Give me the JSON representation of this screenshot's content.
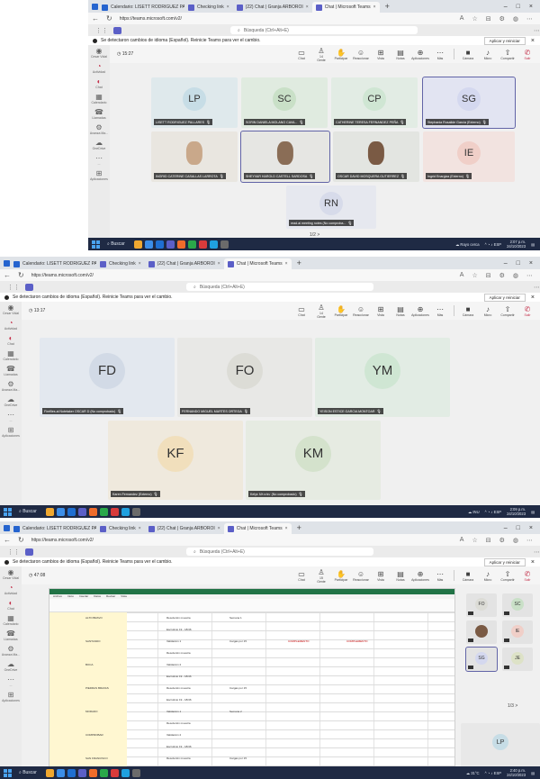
{
  "common": {
    "tabs": [
      {
        "label": "Calendario: LISETT RODRIGUEZ PA",
        "color": "#2564cf"
      },
      {
        "label": "Checking link",
        "color": "#5b5fc7"
      },
      {
        "label": "(22) Chat | Granja ARBOROI",
        "color": "#5b5fc7"
      },
      {
        "label": "Chat | Microsoft Teams",
        "color": "#5b5fc7"
      }
    ],
    "url": "https://teams.microsoft.com/v2/",
    "search_placeholder": "Búsqueda (Ctrl+Alt+E)",
    "banner_text": "Se detectaron cambios de idioma (Español). Reinicie Teams para ver el cambio.",
    "banner_button": "Aplicar y reiniciar",
    "rail": [
      "Cesar Vidal",
      "Actividad",
      "Chat",
      "Calendario",
      "Llamadas",
      "Avanza Ma...",
      "OneDrive",
      "...",
      "Aplicaciones"
    ],
    "controls": [
      "Chat",
      "Gente",
      "Participar",
      "Reaccionar",
      "Vista",
      "Notas",
      "Aplicaciones",
      "Más",
      "Cámara",
      "Micro",
      "Compartir",
      "Salir"
    ],
    "taskbar_search": "Buscar",
    "brand_color": "#5b5fc7"
  },
  "shot1": {
    "timer": "15:27",
    "people_count": "14",
    "pager": "1/2 >",
    "weather": "Rayo cerca",
    "clock": [
      "2:07 p.m.",
      "24/10/2023"
    ],
    "tiles": [
      {
        "initials": "LP",
        "name": "LISETT RODRIGUEZ PALLARES",
        "bg": "#dfe9ec",
        "av": "#c7dde6"
      },
      {
        "initials": "SC",
        "name": "SORIN DANIELA MOLANO CAVA...",
        "bg": "#e0ebe0",
        "av": "#c9e0c7"
      },
      {
        "initials": "CP",
        "name": "CATHERINE TERESA FERNANDEZ PEÑA",
        "bg": "#e2ece4",
        "av": "#cfe6d3"
      },
      {
        "initials": "SG",
        "name": "Stephania Rosalide García (Externo)",
        "bg": "#e2e4f2",
        "av": "#d4d8ef"
      },
      {
        "initials": "",
        "name": "INGRID CATERINE CASALLAS LARROTA",
        "bg": "#e9e6e0",
        "av": "#c9a88a"
      },
      {
        "initials": "",
        "name": "SHEYVAR HAROLD CASTELL SARDOSA",
        "bg": "#e6e6e3",
        "av": "#8a6d56"
      },
      {
        "initials": "",
        "name": "OSCAR DAVID MOSQUERA GUTIERREZ",
        "bg": "#e3e5e1",
        "av": "#7a5a44"
      },
      {
        "initials": "IE",
        "name": "Ingrid Enargiza (Externo)",
        "bg": "#f2e3e0",
        "av": "#f0cfc8"
      },
      {
        "initials": "RN",
        "name": "read.ai meeting notes (No comproba...",
        "bg": "#e6e8ef",
        "av": "#d7dbea"
      }
    ]
  },
  "shot2": {
    "timer": "13:17",
    "people_count": "14",
    "pager": "< 2/2 >",
    "weather": "INU",
    "clock": [
      "2:09 p.m.",
      "24/10/2023"
    ],
    "tiles": [
      {
        "initials": "FD",
        "name": "Fireflies.ai Notetaker OSCAR D (No comprobado)",
        "bg": "#e3e8ef",
        "av": "#d2dae6"
      },
      {
        "initials": "FO",
        "name": "FERNANDO MIGUEL MARTES ORTEGA",
        "bg": "#e8e8e6",
        "av": "#dcdcd6"
      },
      {
        "initials": "YM",
        "name": "YEISON ESTICE GARCIA MONTOAR",
        "bg": "#e2ece4",
        "av": "#cfe6d3"
      },
      {
        "initials": "KF",
        "name": "Karen Fernandez (Externo)",
        "bg": "#efe9dd",
        "av": "#f1dfbc"
      },
      {
        "initials": "KM",
        "name": "Kelys Méndez (No comprobado)",
        "bg": "#e6ebe2",
        "av": "#d4e2cc"
      }
    ]
  },
  "shot3": {
    "timer": "47:08",
    "people_count": "15",
    "pager": "1/3 >",
    "weather": "31°C",
    "clock": [
      "2:40 p.m.",
      "24/10/2023"
    ],
    "sharing_label": "Stephania Rosalide Garcia (Externo)",
    "sheet_rows": [
      {
        "a": "ALTO BRAVO",
        "b": "Resolución muestra",
        "c": "Semana 1",
        "d": "",
        "e": ""
      },
      {
        "a": "",
        "b": "Escrutinio 19 - 18/46",
        "c": "",
        "d": "",
        "e": ""
      },
      {
        "a": "SANTANDO",
        "b": "Validación 1",
        "c": "Cargas por 15",
        "d": "COMPLEMENTO",
        "e": "COMPLEMENTO"
      },
      {
        "a": "",
        "b": "Resolución muestra",
        "c": "",
        "d": "",
        "e": ""
      },
      {
        "a": "BOCA",
        "b": "Validación 2",
        "c": "",
        "d": "",
        "e": ""
      },
      {
        "a": "",
        "b": "Escrutinio 19 - 18/46",
        "c": "",
        "d": "",
        "e": ""
      },
      {
        "a": "PIEDRAS BRAVAS",
        "b": "Resolución muestra",
        "c": "Cargas por 15",
        "d": "",
        "e": ""
      },
      {
        "a": "",
        "b": "Escrutinio 19 - 18/46",
        "c": "",
        "d": "",
        "e": ""
      },
      {
        "a": "MORADO",
        "b": "Validación 1",
        "c": "Semana 2",
        "d": "",
        "e": ""
      },
      {
        "a": "",
        "b": "Resolución muestra",
        "c": "",
        "d": "",
        "e": ""
      },
      {
        "a": "COMPROBAR",
        "b": "Validación 2",
        "c": "",
        "d": "",
        "e": ""
      },
      {
        "a": "",
        "b": "Escrutinio 19 - 18/46",
        "c": "",
        "d": "",
        "e": ""
      },
      {
        "a": "SAN FRANCISCO",
        "b": "Resolución muestra",
        "c": "Cargas por 15",
        "d": "",
        "e": ""
      }
    ],
    "mini_tiles": [
      {
        "initials": "FO",
        "av": "#dcdcd6"
      },
      {
        "initials": "SC",
        "av": "#c9e0c7"
      },
      {
        "initials": "",
        "av": "#7a5a44"
      },
      {
        "initials": "IE",
        "av": "#f0cfc8"
      },
      {
        "initials": "SG",
        "av": "#d4d8ef"
      },
      {
        "initials": "JE",
        "av": "#dde2c7"
      }
    ],
    "lp_initials": "LP"
  }
}
